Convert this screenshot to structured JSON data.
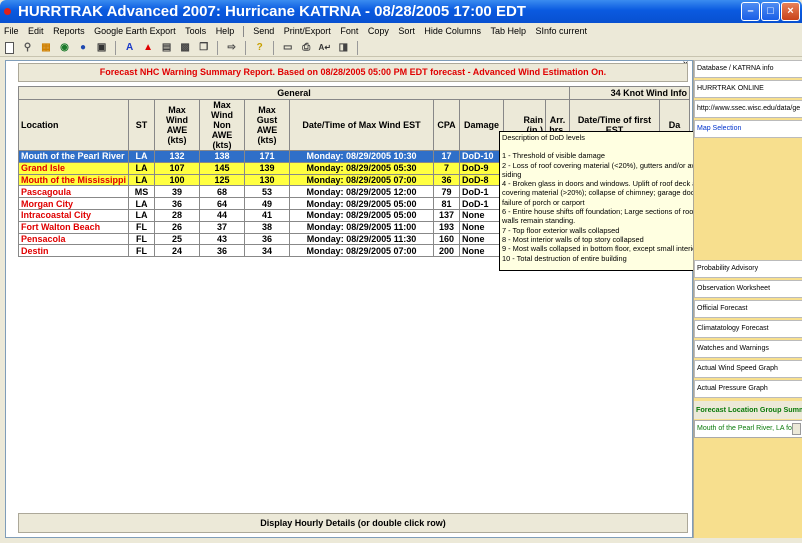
{
  "window": {
    "title": "HURRTRAK Advanced 2007: Hurricane KATRNA - 08/28/2005 17:00 EDT"
  },
  "menu": [
    "File",
    "Edit",
    "Reports",
    "Google Earth Export",
    "Tools",
    "Help",
    "Send",
    "Print/Export",
    "Font",
    "Copy",
    "Sort",
    "Hide Columns",
    "Tab Help",
    "SInfo current"
  ],
  "toolbar_icons": [
    "new-icon",
    "find-icon",
    "chart-icon",
    "globe-icon",
    "map-icon",
    "save-icon",
    "text-a-blue-icon",
    "warning-icon",
    "page-icon",
    "clipboard-icon",
    "copy-icon",
    "send-icon",
    "help-icon",
    "image-icon",
    "print-icon",
    "font-icon",
    "paste-icon"
  ],
  "report": {
    "banner": "Forecast NHC Warning Summary Report. Based on 08/28/2005 05:00 PM EDT forecast - Advanced Wind Estimation On.",
    "group_general": "General",
    "group_34kt": "34 Knot Wind Info",
    "columns": {
      "location": "Location",
      "st": "ST",
      "max_wind_awe": "Max Wind AWE (kts)",
      "max_wind_non_awe": "Max Wind Non AWE (kts)",
      "max_gust_awe": "Max Gust AWE (kts)",
      "datetime_max_wind": "Date/Time of Max Wind EST",
      "cpa": "CPA",
      "damage": "Damage",
      "rain": "Rain (in.)",
      "arr_hrs": "Arr. hrs.",
      "datetime_first": "Date/Time of first EST",
      "da": "Da"
    },
    "rows": [
      {
        "location": "Mouth of the Pearl River",
        "st": "LA",
        "awe": "132",
        "non_awe": "138",
        "gust": "171",
        "date": "Monday: 08/29/2005 10:30",
        "cpa": "17",
        "damage": "DoD-10"
      },
      {
        "location": "Grand Isle",
        "st": "LA",
        "awe": "107",
        "non_awe": "145",
        "gust": "139",
        "date": "Monday: 08/29/2005 05:30",
        "cpa": "7",
        "damage": "DoD-9"
      },
      {
        "location": "Mouth of the Mississippi",
        "st": "LA",
        "awe": "100",
        "non_awe": "125",
        "gust": "130",
        "date": "Monday: 08/29/2005 07:00",
        "cpa": "36",
        "damage": "DoD-8"
      },
      {
        "location": "Pascagoula",
        "st": "MS",
        "awe": "39",
        "non_awe": "68",
        "gust": "53",
        "date": "Monday: 08/29/2005 12:00",
        "cpa": "79",
        "damage": "DoD-1"
      },
      {
        "location": "Morgan City",
        "st": "LA",
        "awe": "36",
        "non_awe": "64",
        "gust": "49",
        "date": "Monday: 08/29/2005 05:00",
        "cpa": "81",
        "damage": "DoD-1"
      },
      {
        "location": "Intracoastal City",
        "st": "LA",
        "awe": "28",
        "non_awe": "44",
        "gust": "41",
        "date": "Monday: 08/29/2005 05:00",
        "cpa": "137",
        "damage": "None"
      },
      {
        "location": "Fort Walton Beach",
        "st": "FL",
        "awe": "26",
        "non_awe": "37",
        "gust": "38",
        "date": "Monday: 08/29/2005 11:00",
        "cpa": "193",
        "damage": "None"
      },
      {
        "location": "Pensacola",
        "st": "FL",
        "awe": "25",
        "non_awe": "43",
        "gust": "36",
        "date": "Monday: 08/29/2005 11:30",
        "cpa": "160",
        "damage": "None"
      },
      {
        "location": "Destin",
        "st": "FL",
        "awe": "24",
        "non_awe": "36",
        "gust": "34",
        "date": "Monday: 08/29/2005 07:00",
        "cpa": "200",
        "damage": "None"
      }
    ],
    "bottom_button": "Display Hourly Details (or double click row)"
  },
  "tooltip": {
    "title": "Description of DoD levels",
    "lines": [
      "1 - Threshold of visible damage",
      "2 - Loss of roof covering material (<20%), gutters and/or awning; loss of vinyl or metal siding",
      "4 - Broken glass in doors and windows. Uplift of roof deck and loss of significant roof covering material (>20%); collapse of chimney; garage doors collapse inward or outward; failure of porch or carport",
      "6 - Entire house shifts off foundation; Large sections of roof structure removed; most walls remain standing.",
      "7 - Top floor exterior walls collapsed",
      "8 - Most interior walls of top story collapsed",
      "9 - Most walls collapsed in bottom floor, except small interior rooms",
      "10 - Total destruction of entire building"
    ]
  },
  "right_panel": {
    "items": [
      "Database / KATRNA info",
      "HURRTRAK ONLINE",
      "http://www.ssec.wisc.edu/data/ge",
      "Map Selection",
      "Probability Advisory",
      "Observation Worksheet",
      "Official Forecast",
      "Climatatology Forecast",
      "Watches and Warnings",
      "Actual Wind Speed Graph",
      "Actual Pressure Graph"
    ],
    "group_title": "Forecast Location Group Summ",
    "group_value": "Mouth of the Pearl River, LA  fo"
  },
  "colors": {
    "selected_row": "#2f6fc8",
    "highlight_row": "#ffff40",
    "location_text": "#e00000",
    "right_panel_bg": "#f7df8e"
  }
}
